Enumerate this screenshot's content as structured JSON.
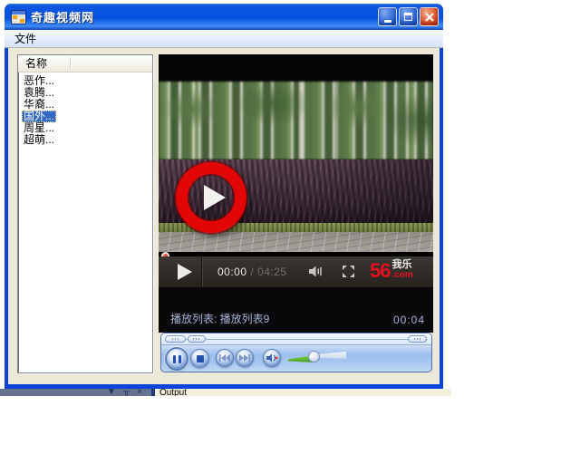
{
  "window": {
    "title": "奇趣视频网",
    "controls": {
      "minimize": "minimize",
      "maximize": "maximize",
      "close": "close"
    }
  },
  "menu": {
    "items": [
      {
        "label": "文件"
      }
    ]
  },
  "list": {
    "header": "名称",
    "items": [
      {
        "label": "恶作...",
        "selected": false
      },
      {
        "label": "袁腾...",
        "selected": false
      },
      {
        "label": "华裔...",
        "selected": false
      },
      {
        "label": "国外...",
        "selected": true
      },
      {
        "label": "周星...",
        "selected": false
      },
      {
        "label": "超萌...",
        "selected": false
      }
    ]
  },
  "player": {
    "time_current": "00:00",
    "time_separator": "/",
    "time_total": "04:25",
    "logo": {
      "number": "56",
      "tld": ".com",
      "slogan": "我乐"
    },
    "playlist_label": "播放列表: 播放列表9",
    "playlist_time": "00:04",
    "icons": [
      "play-icon",
      "volume-icon",
      "fullscreen-icon",
      "seek-knob"
    ]
  },
  "wmp_bar": {
    "icons": [
      "pause-icon",
      "stop-icon",
      "previous-icon",
      "next-icon",
      "mute-icon",
      "volume-slider"
    ]
  },
  "statusbar": {
    "output_label": "Output",
    "icons": {
      "dropdown": "▼",
      "pin": "╥",
      "close": "×"
    }
  },
  "colors": {
    "titlebar_blue": "#0c43d9",
    "selection_blue": "#316ac5",
    "logo_red": "#e8101e",
    "volume_green": "#4fae1f",
    "control_bar_dark": "#2d2a26",
    "wmp_blue": "#a9c8ef",
    "form_background": "#ece9d8"
  }
}
